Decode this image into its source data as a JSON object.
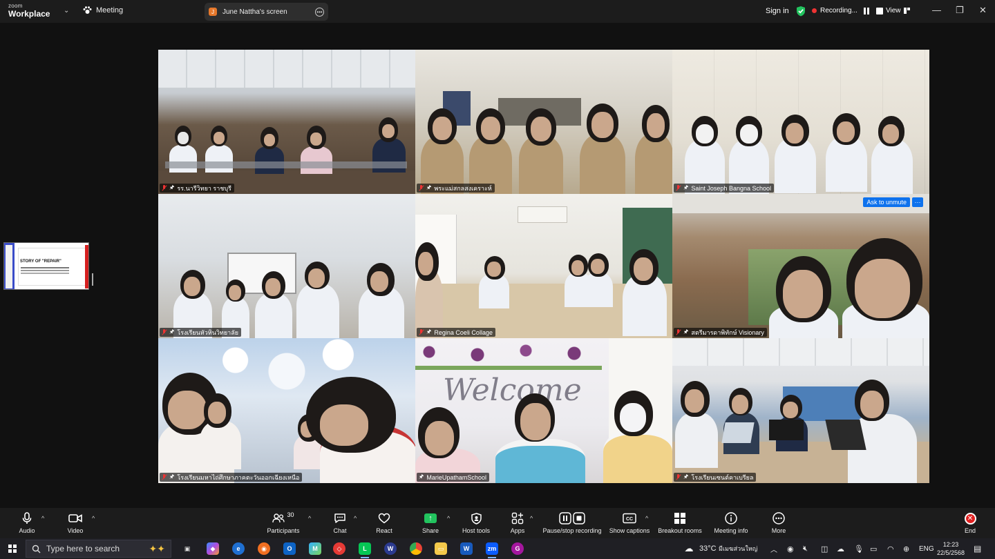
{
  "app": {
    "brand_small": "zoom",
    "brand_big": "Workplace",
    "meeting_label": "Meeting"
  },
  "share_indicator": {
    "avatar_letter": "J",
    "label": "June Nattha's screen"
  },
  "topbar": {
    "sign_in": "Sign in",
    "recording": "Recording...",
    "view": "View"
  },
  "tiles": [
    {
      "name": "รร.นารีวิทยา ราชบุรี",
      "muted": true,
      "pinned": true
    },
    {
      "name": "พระแม่สกลสงเคราะห์",
      "muted": true,
      "pinned": true
    },
    {
      "name": "Saint Joseph Bangna School",
      "muted": true,
      "pinned": true
    },
    {
      "name": "โรงเรียนหัวหินวิทยาลัย",
      "muted": true,
      "pinned": true
    },
    {
      "name": "Regina Coeli Collage",
      "muted": true,
      "pinned": true
    },
    {
      "name": "สตรีมารดาพิทักษ์ Visionary",
      "muted": true,
      "pinned": true,
      "ask_to_unmute": "Ask to unmute",
      "more_label": "···"
    },
    {
      "name": "โรงเรียนมหาไถ่ศึกษาภาคตะวันออกเฉียงเหนือ",
      "muted": true,
      "pinned": true
    },
    {
      "name": "MarieUpathamSchool",
      "muted": false,
      "pinned": true,
      "active_speaker": true,
      "wall_text": "Welcome"
    },
    {
      "name": "โรงเรียนเซนต์คาเบรียล",
      "muted": true,
      "pinned": true
    }
  ],
  "thumbnail": {
    "slide_title": "STORY OF \"REPAIR\""
  },
  "toolbar": {
    "audio": "Audio",
    "video": "Video",
    "participants": "Participants",
    "participants_count": "30",
    "chat": "Chat",
    "react": "React",
    "share": "Share",
    "host_tools": "Host tools",
    "apps": "Apps",
    "pause_stop": "Pause/stop recording",
    "captions": "Show captions",
    "breakout": "Breakout rooms",
    "meeting_info": "Meeting info",
    "more": "More",
    "end": "End"
  },
  "taskbar": {
    "search_placeholder": "Type here to search",
    "weather": "33°C",
    "weather_desc": "มีเมฆส่วนใหญ่",
    "lang": "ENG",
    "time": "12:23",
    "date": "22/5/2568"
  },
  "colors": {
    "active_speaker": "#27c86a",
    "muted": "#e33333",
    "accent_blue": "#0e72ed",
    "end_red": "#e02020"
  }
}
